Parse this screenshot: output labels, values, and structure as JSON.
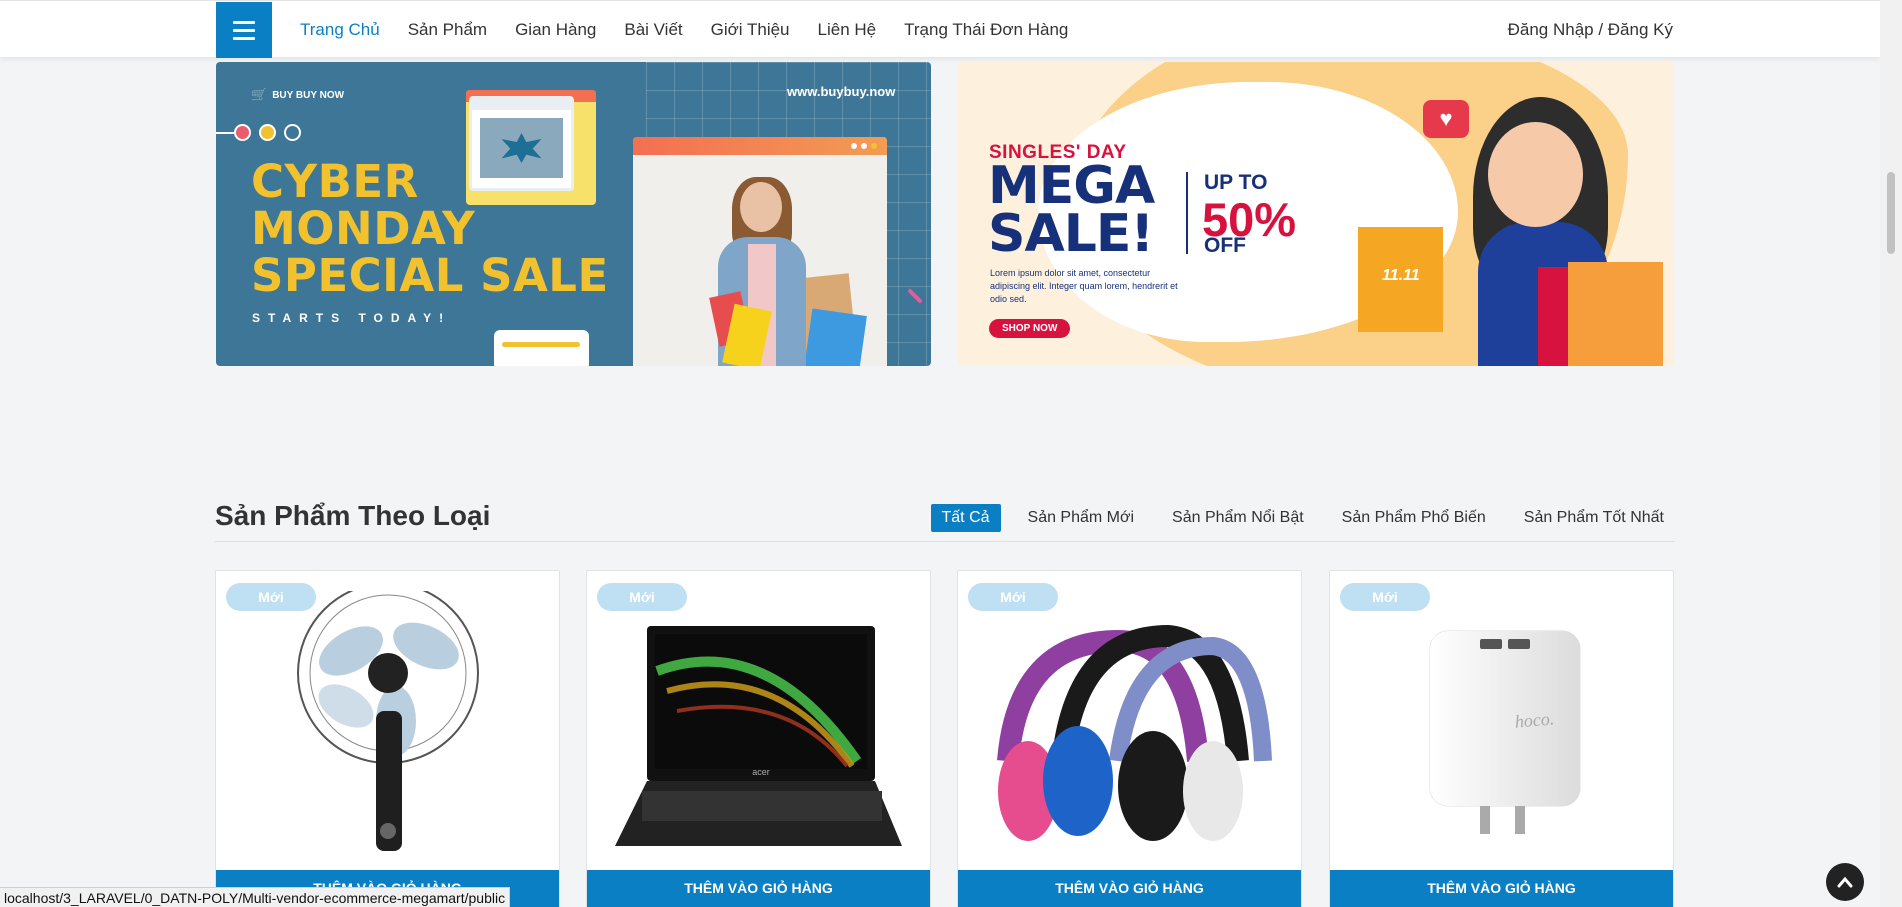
{
  "header": {
    "menu_icon": "hamburger-icon",
    "nav": [
      {
        "label": "Trang Chủ",
        "active": true
      },
      {
        "label": "Sản Phẩm"
      },
      {
        "label": "Gian Hàng"
      },
      {
        "label": "Bài Viết"
      },
      {
        "label": "Giới Thiệu"
      },
      {
        "label": "Liên Hệ"
      },
      {
        "label": "Trạng Thái Đơn Hàng"
      }
    ],
    "login": "Đăng Nhập / Đăng Ký"
  },
  "banners": {
    "left": {
      "brand": "BUY BUY NOW",
      "website": "www.buybuy.now",
      "title_lines": [
        "CYBER",
        "MONDAY",
        "SPECIAL SALE"
      ],
      "subtitle": "STARTS TODAY!"
    },
    "right": {
      "eyebrow": "SINGLES' DAY",
      "title_lines": [
        "MEGA",
        "SALE!"
      ],
      "up_to": "UP TO",
      "percent": "50%",
      "off": "OFF",
      "body": "Lorem ipsum dolor sit amet, consectetur adipiscing elit. Integer quam lorem, hendrerit et odio sed.",
      "cta": "SHOP NOW",
      "bag_label": "11.11"
    }
  },
  "section": {
    "title": "Sản Phẩm Theo Loại",
    "tabs": [
      {
        "label": "Tất Cả",
        "active": true
      },
      {
        "label": "Sản Phẩm Mới"
      },
      {
        "label": "Sản Phẩm Nổi Bật"
      },
      {
        "label": "Sản Phẩm Phổ Biến"
      },
      {
        "label": "Sản Phẩm Tốt Nhất"
      }
    ]
  },
  "products": [
    {
      "badge": "Mới",
      "cart_label": "THÊM VÀO GIỎ HÀNG",
      "image": "standing-fan"
    },
    {
      "badge": "Mới",
      "cart_label": "THÊM VÀO GIỎ HÀNG",
      "image": "acer-laptop",
      "brand_text": "acer"
    },
    {
      "badge": "Mới",
      "cart_label": "THÊM VÀO GIỎ HÀNG",
      "image": "headphones"
    },
    {
      "badge": "Mới",
      "cart_label": "THÊM VÀO GIỎ HÀNG",
      "image": "usb-charger",
      "brand_text": "hoco."
    }
  ],
  "status_url": "localhost/3_LARAVEL/0_DATN-POLY/Multi-vendor-ecommerce-megamart/public",
  "colors": {
    "primary": "#0a7fc4",
    "badge": "#bfe0f3",
    "page_bg": "#f3f4f6"
  }
}
